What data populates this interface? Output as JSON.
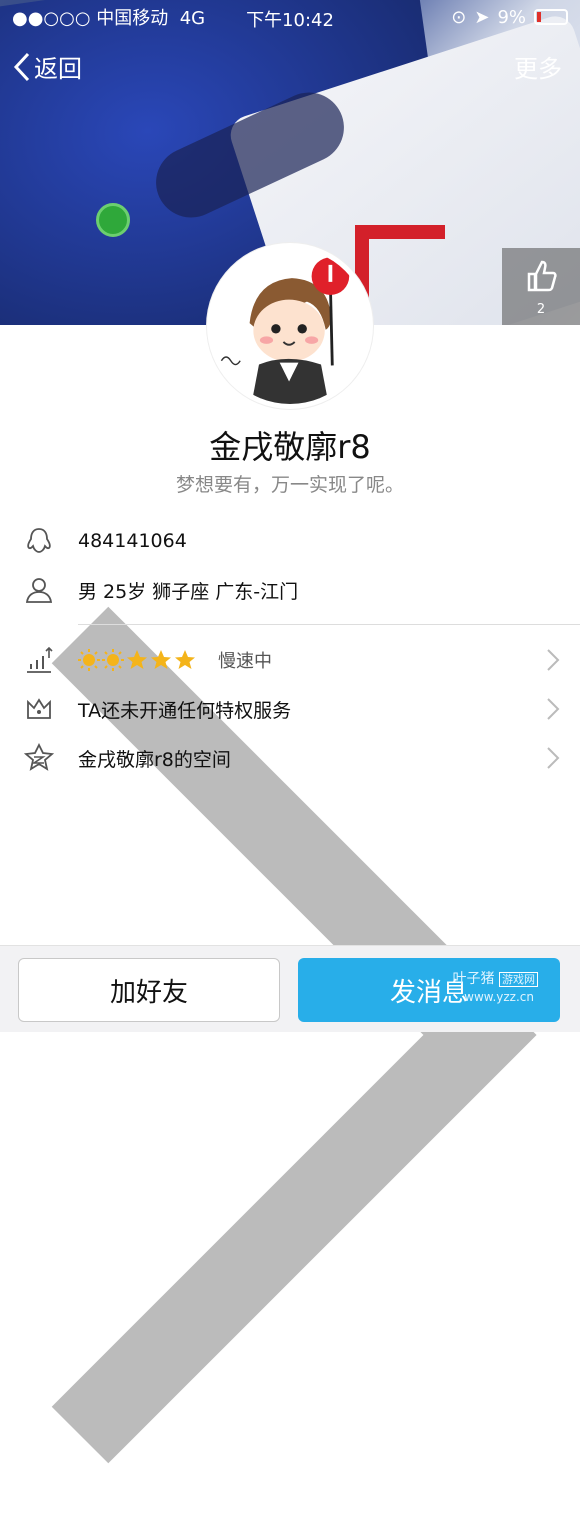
{
  "status_bar": {
    "carrier": "●●○○○ 中国移动",
    "network": "4G",
    "time": "下午10:42",
    "battery": "9%"
  },
  "nav": {
    "back_label": "返回",
    "more_label": "更多"
  },
  "like": {
    "count": "2"
  },
  "profile": {
    "name": "金戌敬廓r8",
    "signature": "梦想要有，万一实现了呢。"
  },
  "info": {
    "qq": "484141064",
    "details": "男 25岁 狮子座 广东-江门",
    "level_speed": "慢速中",
    "level_stars": 5,
    "privilege": "TA还未开通任何特权服务",
    "space": "金戌敬廓r8的空间"
  },
  "buttons": {
    "add_friend": "加好友",
    "send_message": "发消息"
  },
  "watermark": {
    "brand": "叶子猪",
    "tag": "游戏网",
    "url": "www.yzz.cn"
  },
  "colors": {
    "accent": "#28aee9",
    "star": "#f4b41a"
  }
}
